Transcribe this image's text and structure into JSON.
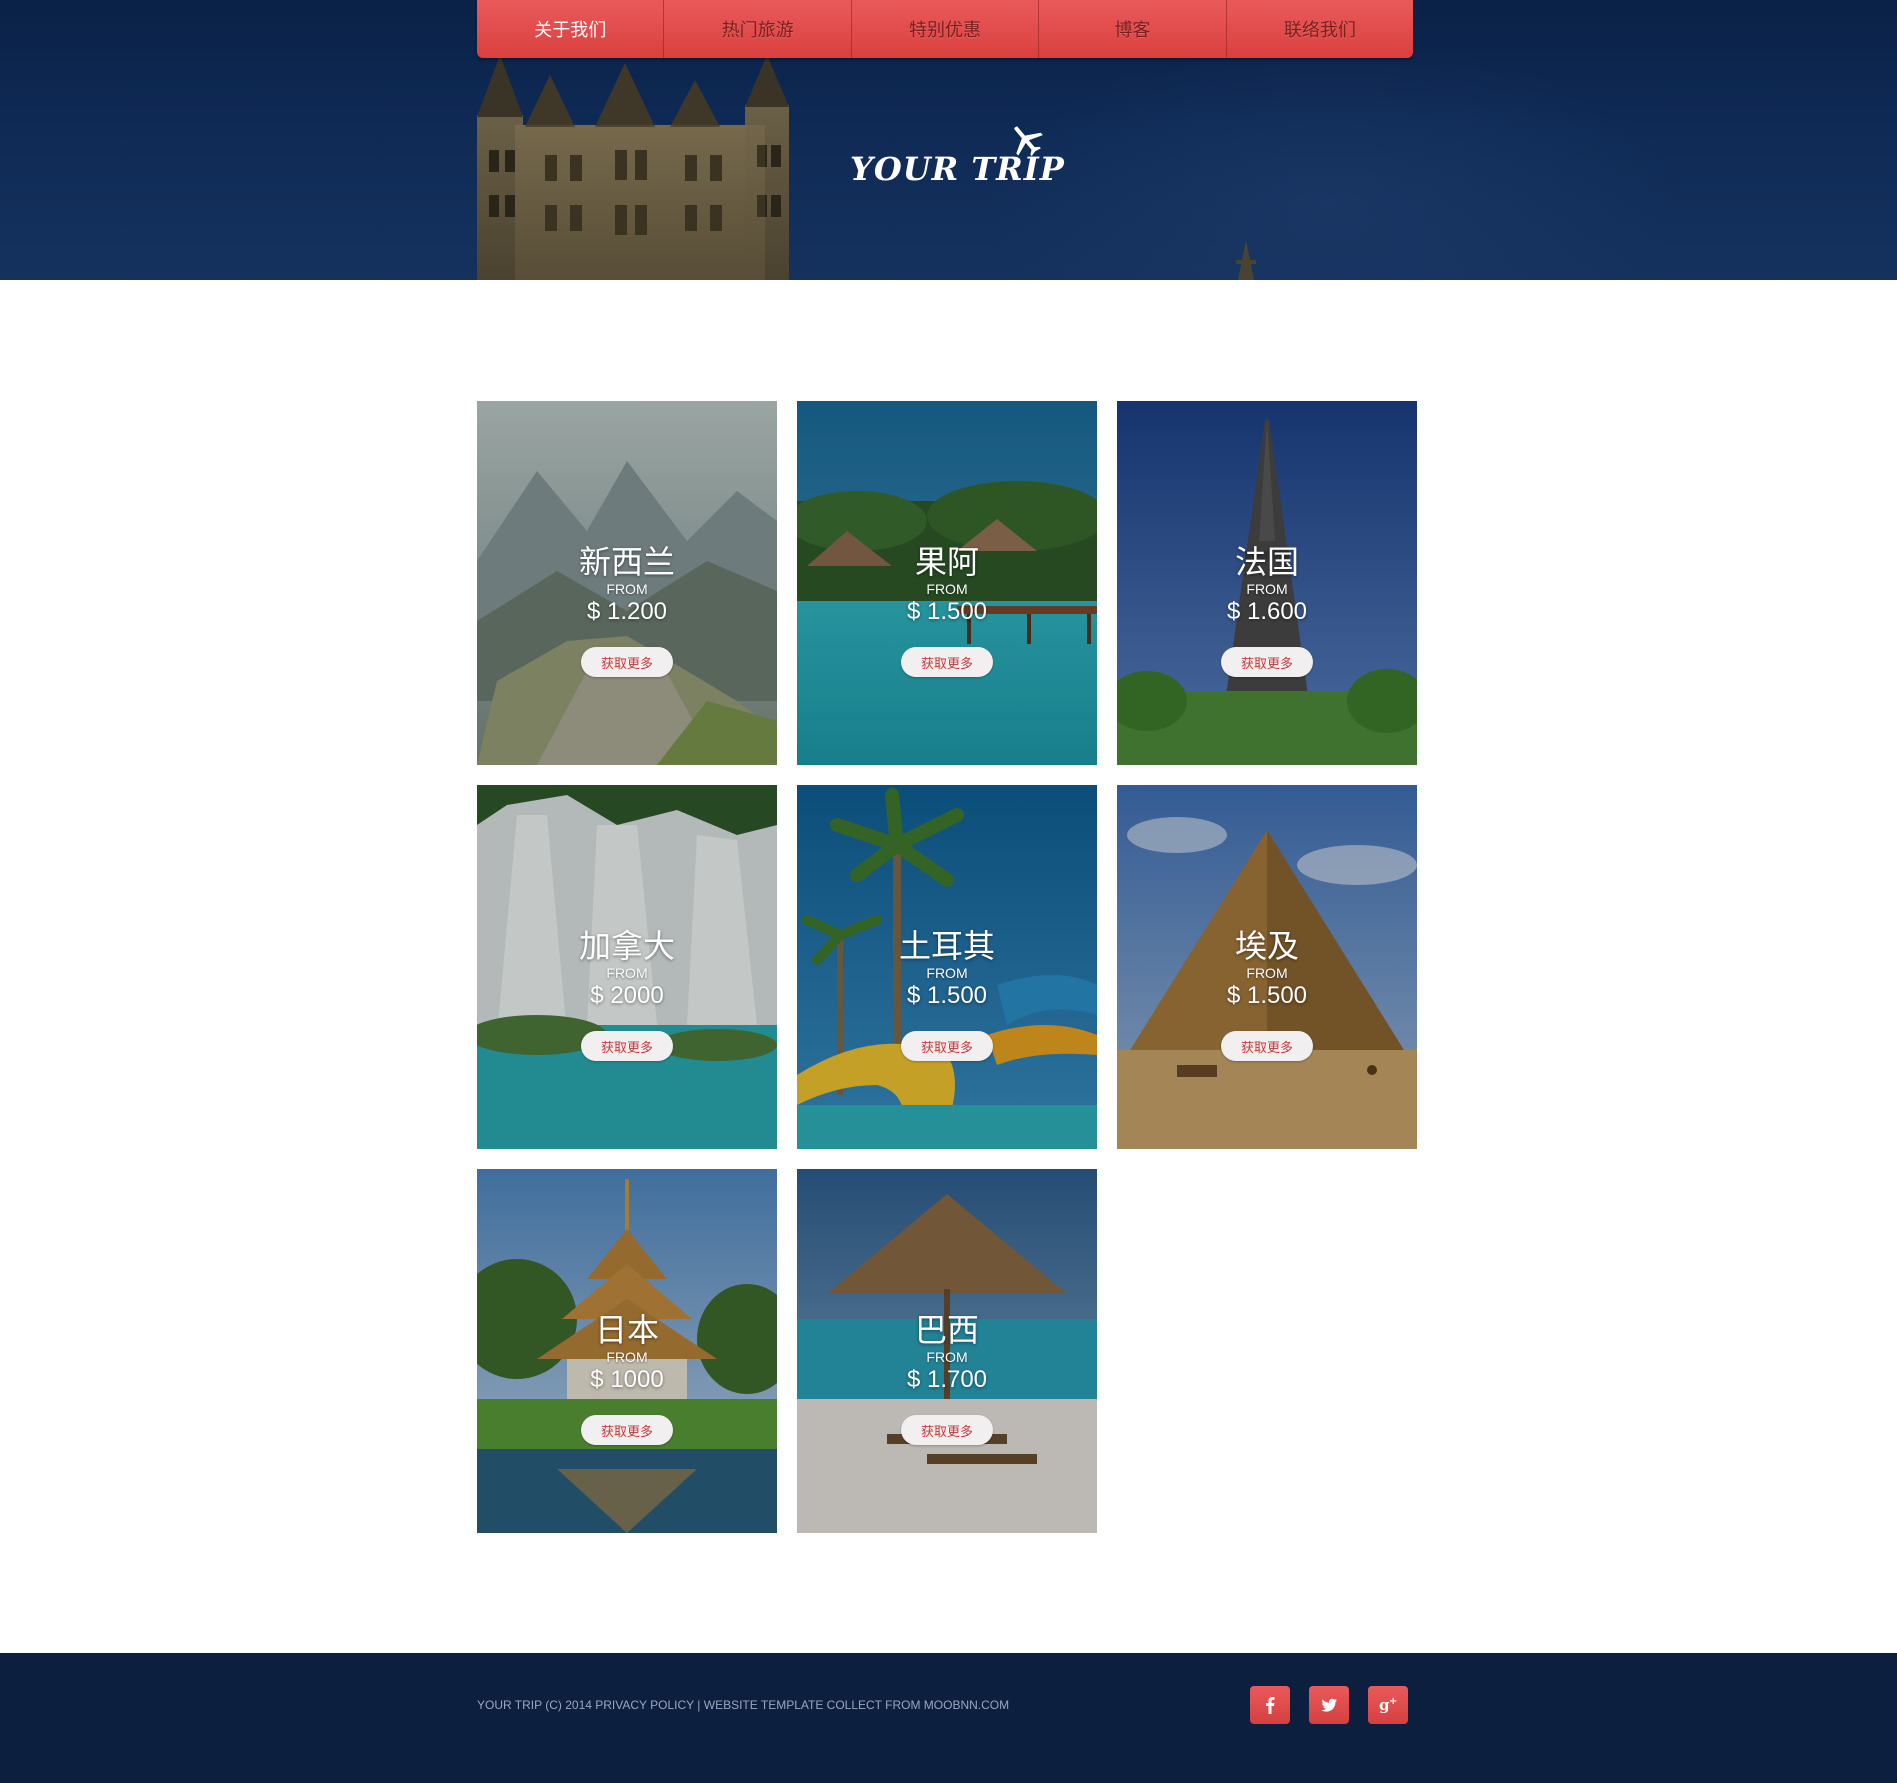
{
  "nav": {
    "items": [
      {
        "label": "关于我们",
        "active": true
      },
      {
        "label": "热门旅游",
        "active": false
      },
      {
        "label": "特别优惠",
        "active": false
      },
      {
        "label": "博客",
        "active": false
      },
      {
        "label": "联络我们",
        "active": false
      }
    ]
  },
  "logo": {
    "text": "YOUR TRIP",
    "icon": "airplane-icon"
  },
  "cards": [
    {
      "name": "新西兰",
      "from": "FROM",
      "price": "$ 1.200",
      "button": "获取更多",
      "scene": "mountain-mist"
    },
    {
      "name": "果阿",
      "from": "FROM",
      "price": "$ 1.500",
      "button": "获取更多",
      "scene": "tropical-pool"
    },
    {
      "name": "法国",
      "from": "FROM",
      "price": "$ 1.600",
      "button": "获取更多",
      "scene": "eiffel-tower"
    },
    {
      "name": "加拿大",
      "from": "FROM",
      "price": "$ 2000",
      "button": "获取更多",
      "scene": "waterfall"
    },
    {
      "name": "土耳其",
      "from": "FROM",
      "price": "$ 1.500",
      "button": "获取更多",
      "scene": "palm-waterslide"
    },
    {
      "name": "埃及",
      "from": "FROM",
      "price": "$ 1.500",
      "button": "获取更多",
      "scene": "pyramid"
    },
    {
      "name": "日本",
      "from": "FROM",
      "price": "$ 1000",
      "button": "获取更多",
      "scene": "pagoda"
    },
    {
      "name": "巴西",
      "from": "FROM",
      "price": "$ 1.700",
      "button": "获取更多",
      "scene": "beach-umbrella"
    }
  ],
  "footer": {
    "text": "YOUR TRIP (C) 2014 PRIVACY POLICY | WEBSITE TEMPLATE COLLECT FROM MOOBNN.COM",
    "social": [
      {
        "name": "facebook-icon",
        "glyph": "f"
      },
      {
        "name": "twitter-icon",
        "glyph": "t"
      },
      {
        "name": "google-plus-icon",
        "glyph": "g+"
      }
    ]
  },
  "colors": {
    "header_bg": "#0e2a55",
    "nav_red": "#e04b4b",
    "footer_bg": "#0d1f3f",
    "button_text": "#c43a3a"
  }
}
